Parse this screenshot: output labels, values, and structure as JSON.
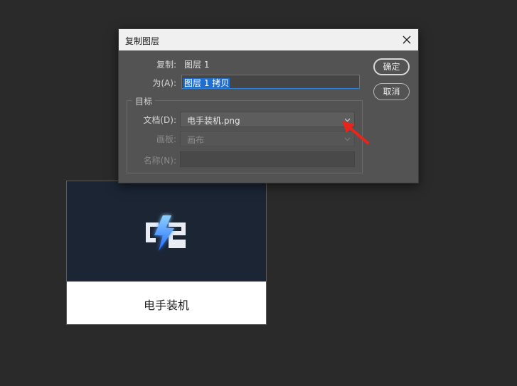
{
  "dialog": {
    "title": "复制图层",
    "source_label": "复制:",
    "source_value": "图层 1",
    "as_label": "为(A):",
    "as_value": "图层 1 拷贝",
    "destination": {
      "group_title": "目标",
      "document_label": "文档(D):",
      "document_value": "电手装机.png",
      "artboard_label": "画板:",
      "artboard_value": "画布",
      "name_label": "名称(N):",
      "name_value": ""
    },
    "ok_label": "确定",
    "cancel_label": "取消"
  },
  "preview": {
    "brand_text": "电手装机"
  },
  "colors": {
    "dialog_bg": "#535353",
    "selection": "#1f6fd0",
    "annotation_arrow": "#e8251c"
  }
}
